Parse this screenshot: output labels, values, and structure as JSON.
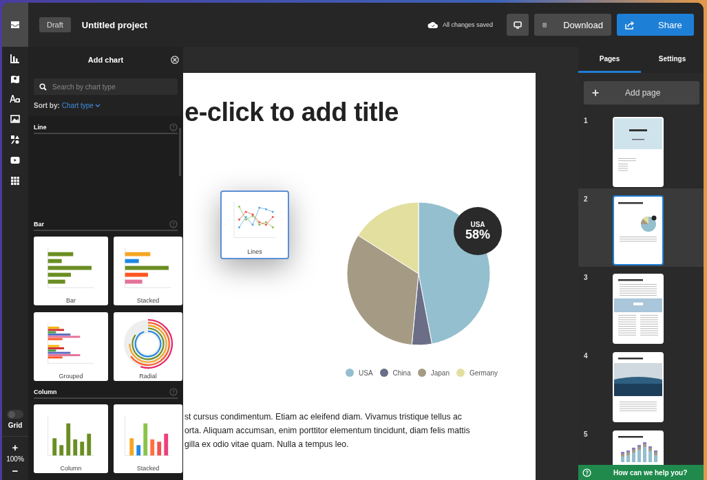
{
  "topbar": {
    "status": "Draft",
    "project": "Untitled project",
    "save_status": "All changes saved",
    "buttons": [
      {
        "label": "Download",
        "kind": "download"
      },
      {
        "label": "Share",
        "kind": "share"
      }
    ]
  },
  "rail": {
    "grid_label": "Grid",
    "grid_on": false,
    "zoom_in": "+",
    "zoom": "100%",
    "zoom_out": "−"
  },
  "chart_panel": {
    "title": "Add chart",
    "search_placeholder": "Search by chart type",
    "sort_label": "Sort by:",
    "sort_value": "Chart type",
    "sections": [
      {
        "title": "Line"
      },
      {
        "title": "Bar",
        "tiles": [
          {
            "label": "Bar",
            "kind": "bar"
          },
          {
            "label": "Stacked",
            "kind": "stacked-bar"
          },
          {
            "label": "Grouped",
            "kind": "grouped"
          },
          {
            "label": "Radial",
            "kind": "radial"
          }
        ]
      },
      {
        "title": "Column",
        "tiles": [
          {
            "label": "Column",
            "kind": "column"
          },
          {
            "label": "Stacked",
            "kind": "stacked-column"
          }
        ]
      }
    ]
  },
  "page": {
    "title": "e-click to add title",
    "dragged_tile": {
      "label": "Lines",
      "kind": "lines"
    },
    "tooltip": {
      "label": "USA",
      "value": "58%"
    },
    "legend": [
      {
        "label": "USA",
        "color": "#94bfcf"
      },
      {
        "label": "China",
        "color": "#6b6e86"
      },
      {
        "label": "Japan",
        "color": "#a59b84"
      },
      {
        "label": "Germany",
        "color": "#e3df9f"
      }
    ],
    "paragraph": [
      "st cursus condimentum. Etiam ac eleifend diam. Vivamus tristique tellus ac",
      "orta. Aliquam accumsan, enim porttitor elementum tincidunt, diam felis mattis",
      "gilla ex odio vitae quam. Nulla a tempus leo."
    ]
  },
  "pages_panel": {
    "tabs": [
      {
        "label": "Pages",
        "selected": true
      },
      {
        "label": "Settings",
        "selected": false
      }
    ],
    "add_page": "Add page",
    "pages": [
      {
        "number": "1",
        "selected": false,
        "kind": "cover"
      },
      {
        "number": "2",
        "selected": true,
        "kind": "pie"
      },
      {
        "number": "3",
        "selected": false,
        "kind": "stat"
      },
      {
        "number": "4",
        "selected": false,
        "kind": "photo"
      },
      {
        "number": "5",
        "selected": false,
        "kind": "columns"
      }
    ],
    "help": "How can we help you?"
  }
}
